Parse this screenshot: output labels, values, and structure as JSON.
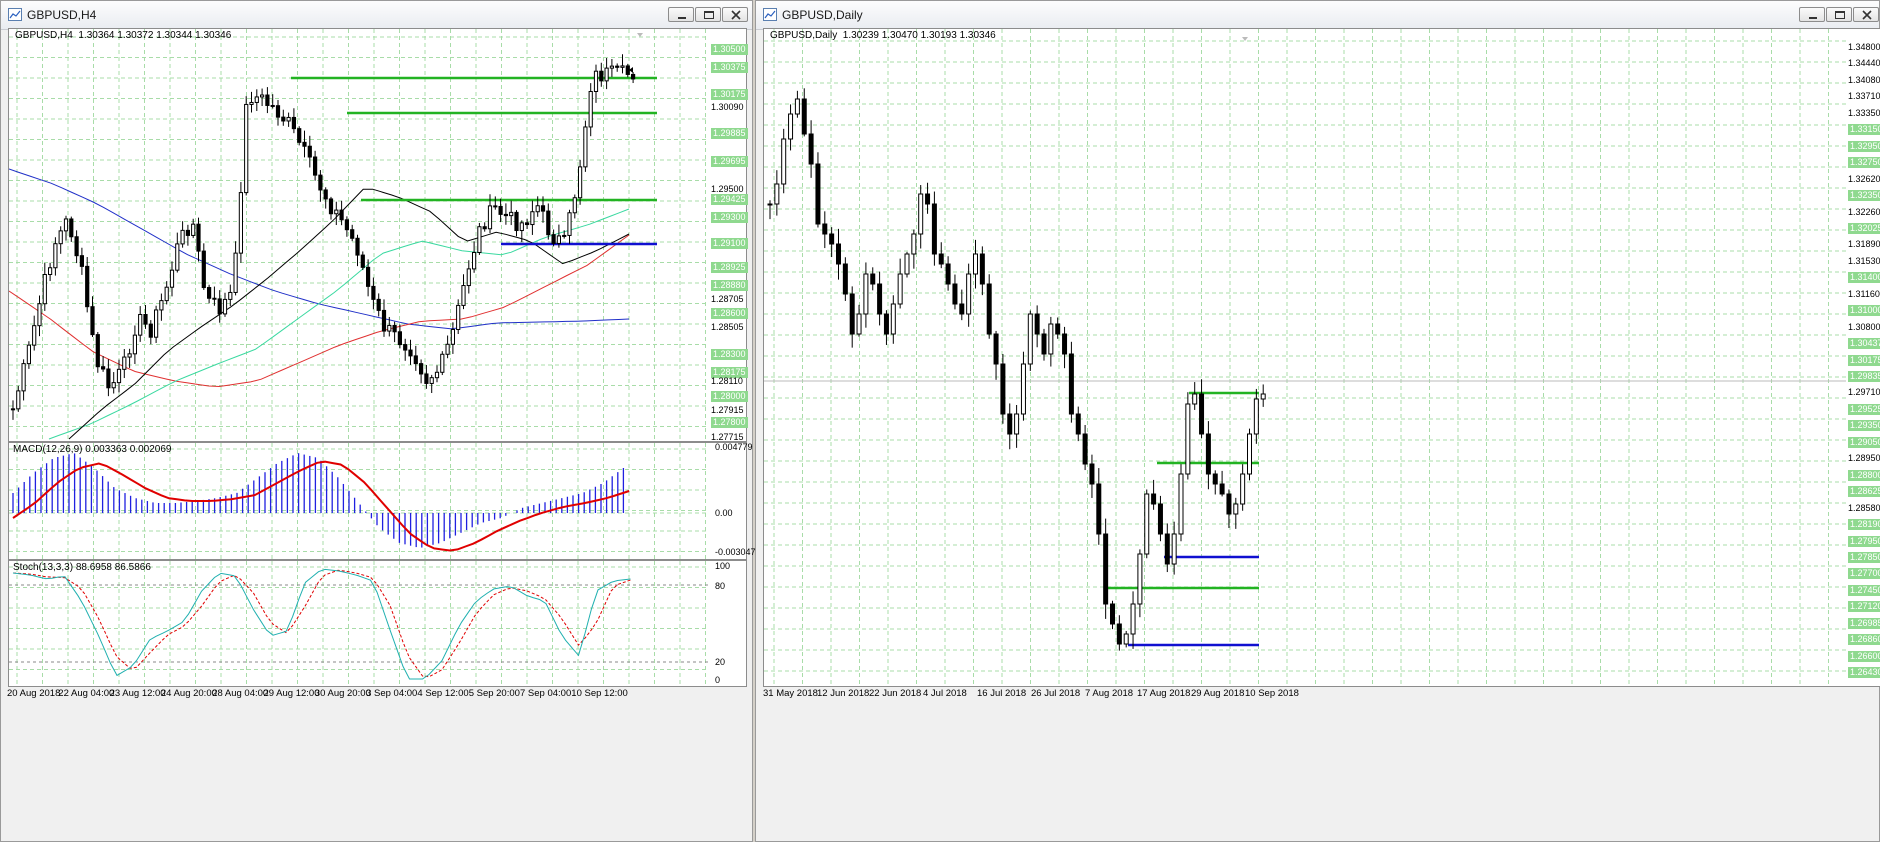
{
  "windows": [
    {
      "title": "GBPUSD,H4",
      "header": "GBPUSD,H4  1.30364 1.30372 1.30344 1.30346",
      "price_labels": [
        "1.30500",
        "1.30375",
        "1.30175",
        "1.30090",
        "1.29885",
        "1.29695",
        "1.29500",
        "1.29425",
        "1.29300",
        "1.29100",
        "1.28925",
        "1.28880",
        "1.28705",
        "1.28600",
        "1.28505",
        "1.28300",
        "1.28175",
        "1.28110",
        "1.28000",
        "1.27915",
        "1.27800",
        "1.27715"
      ],
      "macd": {
        "label": "MACD(12,26,9) 0.003363 0.002069",
        "scale": [
          "0.004779",
          "0.00",
          "-0.003047"
        ]
      },
      "stoch": {
        "label": "Stoch(13,3,3) 88.6958 86.5866",
        "scale": [
          "100",
          "80",
          "20",
          "0"
        ]
      },
      "time_labels": [
        "20 Aug 2018",
        "22 Aug 04:00",
        "23 Aug 12:00",
        "24 Aug 20:00",
        "28 Aug 04:00",
        "29 Aug 12:00",
        "30 Aug 20:00",
        "3 Sep 04:00",
        "4 Sep 12:00",
        "5 Sep 20:00",
        "7 Sep 04:00",
        "10 Sep 12:00"
      ]
    },
    {
      "title": "GBPUSD,Daily",
      "header": "GBPUSD,Daily  1.30239 1.30470 1.30193 1.30346",
      "price_labels": [
        "1.34800",
        "1.34440",
        "1.34080",
        "1.33710",
        "1.33350",
        "1.33150",
        "1.32950",
        "1.32750",
        "1.32620",
        "1.32350",
        "1.32260",
        "1.32025",
        "1.31890",
        "1.31530",
        "1.31400",
        "1.31160",
        "1.31000",
        "1.30800",
        "1.30437",
        "1.30175",
        "1.29835",
        "1.29710",
        "1.29525",
        "1.29350",
        "1.29050",
        "1.28950",
        "1.28800",
        "1.28625",
        "1.28580",
        "1.28190",
        "1.27950",
        "1.27850",
        "1.27700",
        "1.27450",
        "1.27120",
        "1.26985",
        "1.26860",
        "1.26600",
        "1.26430"
      ],
      "time_labels": [
        "31 May 2018",
        "12 Jun 2018",
        "22 Jun 2018",
        "4 Jul 2018",
        "16 Jul 2018",
        "26 Jul 2018",
        "7 Aug 2018",
        "17 Aug 2018",
        "29 Aug 2018",
        "10 Sep 2018"
      ]
    }
  ],
  "colors": {
    "bull": "#ffffff",
    "bear": "#000000",
    "sr_green": "#22b322",
    "sr_blue": "#1010d0",
    "grid": "#a8dca8",
    "ma_fast": "#000000",
    "ma_mid": "#3ad9a0",
    "ma_slow": "#e03030",
    "ma_long": "#2030c8",
    "macd_hist": "#2020e0",
    "macd_signal": "#e00000",
    "stoch_main": "#20b0b0",
    "stoch_signal": "#e00000"
  }
}
